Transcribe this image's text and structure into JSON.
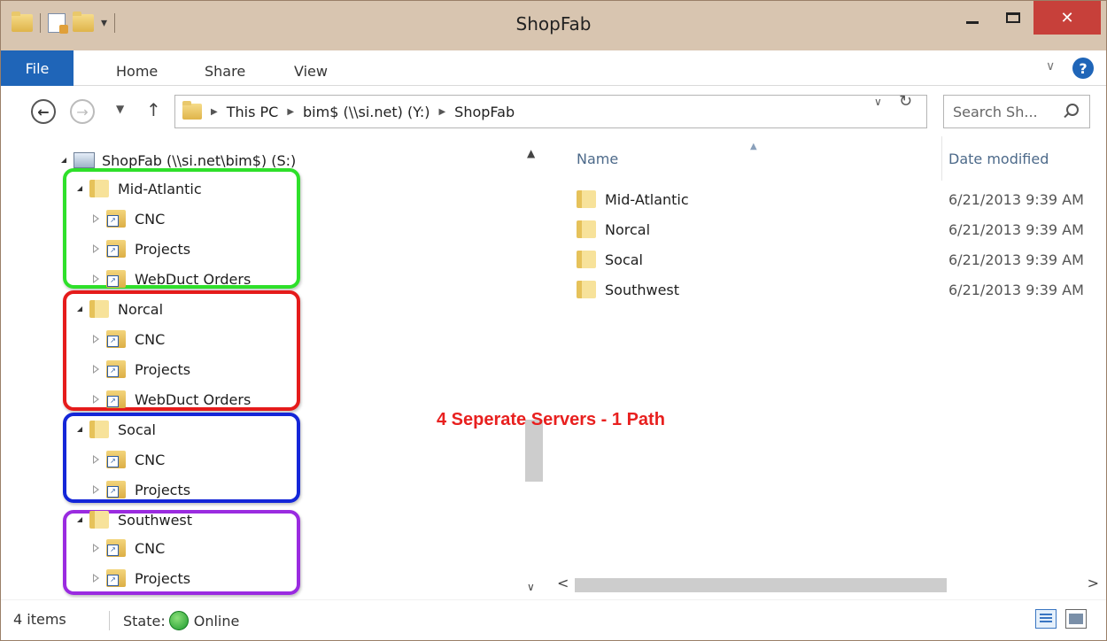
{
  "window": {
    "title": "ShopFab"
  },
  "ribbon": {
    "tabs": [
      "File",
      "Home",
      "Share",
      "View"
    ]
  },
  "address": {
    "crumbs": [
      "This PC",
      "bim$ (\\\\si.net) (Y:)",
      "ShopFab"
    ],
    "search_placeholder": "Search Sh..."
  },
  "navpane": {
    "root": "ShopFab (\\\\si.net\\bim$) (S:)",
    "groups": [
      {
        "name": "Mid-Atlantic",
        "color": "#2ee02a",
        "children": [
          "CNC",
          "Projects",
          "WebDuct Orders"
        ]
      },
      {
        "name": "Norcal",
        "color": "#e51b1b",
        "children": [
          "CNC",
          "Projects",
          "WebDuct Orders"
        ]
      },
      {
        "name": "Socal",
        "color": "#1426d8",
        "children": [
          "CNC",
          "Projects"
        ]
      },
      {
        "name": "Southwest",
        "color": "#9a2be0",
        "children": [
          "CNC",
          "Projects"
        ]
      }
    ]
  },
  "content": {
    "columns": {
      "name": "Name",
      "date": "Date modified"
    },
    "rows": [
      {
        "name": "Mid-Atlantic",
        "date": "6/21/2013 9:39 AM"
      },
      {
        "name": "Norcal",
        "date": "6/21/2013 9:39 AM"
      },
      {
        "name": "Socal",
        "date": "6/21/2013 9:39 AM"
      },
      {
        "name": "Southwest",
        "date": "6/21/2013 9:39 AM"
      }
    ]
  },
  "annotation": {
    "text": "4 Seperate Servers - 1 Path",
    "color": "#e8201f"
  },
  "status": {
    "items": "4 items",
    "state_label": "State:",
    "state_value": "Online"
  },
  "icons": [
    "folder-icon",
    "properties-icon",
    "back-icon",
    "forward-icon",
    "up-icon",
    "refresh-icon",
    "search-icon",
    "network-drive-icon",
    "shortcut-folder-icon",
    "online-icon",
    "details-view-icon",
    "large-icons-view-icon",
    "help-icon"
  ]
}
